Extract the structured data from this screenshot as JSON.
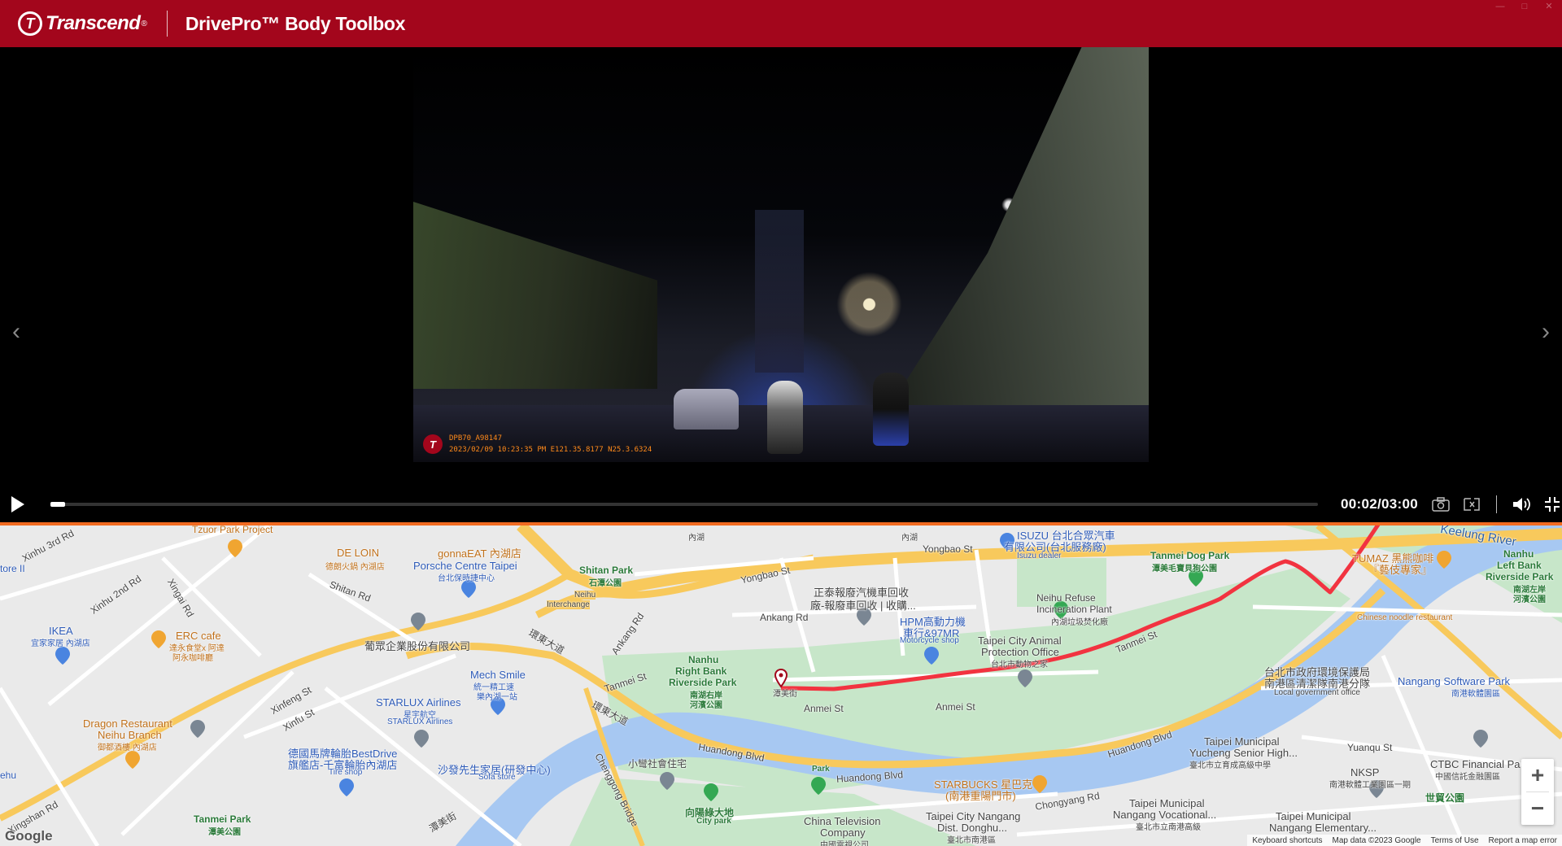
{
  "colors": {
    "brand": "#a3061c",
    "accent": "#f26b21",
    "route": "#f23340",
    "water": "#a7c8f2",
    "park": "#bfe2c2",
    "highway": "#f8c95c"
  },
  "header": {
    "brand_mark": "T",
    "brand_name": "Transcend",
    "brand_reg": "®",
    "app_title": "DrivePro™ Body Toolbox"
  },
  "window_controls": [
    "—",
    "□",
    "✕"
  ],
  "video": {
    "overlay_logo": "T",
    "overlay_line1": "DPB70_A98147",
    "overlay_line2": "2023/02/09 10:23:35 PM  E121.35.8177 N25.3.6324",
    "nav_prev": "‹",
    "nav_next": "›"
  },
  "player": {
    "time": "00:02/03:00",
    "progress_fraction": 0.011,
    "icons": [
      "play-icon",
      "camera-icon",
      "crop-icon",
      "volume-icon",
      "fullscreen-exit-icon"
    ]
  },
  "map": {
    "labels": [
      {
        "text": "Tzuor Park Project",
        "cls": "orange"
      },
      {
        "text": "Xinhu 3rd Rd",
        "cls": "road"
      },
      {
        "text": "tore II",
        "cls": "blue"
      },
      {
        "text": "DE LOIN",
        "cls": "orange"
      },
      {
        "text": "德朗火鍋 內湖店",
        "cls": "orange small"
      },
      {
        "text": "gonnaEAT 內湖店",
        "cls": "orange"
      },
      {
        "text": "Porsche Centre Taipei",
        "cls": "blue"
      },
      {
        "text": "台北保時捷中心",
        "cls": "blue small"
      },
      {
        "text": "Xinhu 2nd Rd",
        "cls": "road"
      },
      {
        "text": "Xingai Rd",
        "cls": "road"
      },
      {
        "text": "Shitan Rd",
        "cls": "road"
      },
      {
        "text": "Shitan Park",
        "cls": "green"
      },
      {
        "text": "石潭公園",
        "cls": "green small"
      },
      {
        "text": "Neihu",
        "cls": "road"
      },
      {
        "text": "Interchange",
        "cls": "road"
      },
      {
        "text": "內湖",
        "cls": "road small"
      },
      {
        "text": "內湖",
        "cls": "road small"
      },
      {
        "text": "Yongbao St",
        "cls": "road"
      },
      {
        "text": "Yongbao St",
        "cls": "road"
      },
      {
        "text": "ISUZU 台北合眾汽車",
        "cls": "blue"
      },
      {
        "text": "有限公司(台北服務廠)",
        "cls": "blue"
      },
      {
        "text": "Isuzu dealer",
        "cls": "blue small"
      },
      {
        "text": "Tanmei Dog Park",
        "cls": "green"
      },
      {
        "text": "潭美毛寶貝狗公園",
        "cls": "green small"
      },
      {
        "text": "Keelung River",
        "cls": "river"
      },
      {
        "text": "TUMAZ 黑熊咖啡",
        "cls": "orange"
      },
      {
        "text": "『藝伎專家』",
        "cls": "orange"
      },
      {
        "text": "Nanhu",
        "cls": "green"
      },
      {
        "text": "Left Bank",
        "cls": "green"
      },
      {
        "text": "Riverside Park",
        "cls": "green"
      },
      {
        "text": "南湖左岸",
        "cls": "green small"
      },
      {
        "text": "河濱公園",
        "cls": "green small"
      },
      {
        "text": "正泰報廢汽機車回收",
        "cls": "road"
      },
      {
        "text": "廠-報廢車回收 | 收購...",
        "cls": "road"
      },
      {
        "text": "Neihu Refuse",
        "cls": "road"
      },
      {
        "text": "Incineration Plant",
        "cls": "road"
      },
      {
        "text": "內湖垃圾焚化廠",
        "cls": "road small"
      },
      {
        "text": "IKEA",
        "cls": "blue"
      },
      {
        "text": "宜家家居 內湖店",
        "cls": "blue small"
      },
      {
        "text": "ERC cafe",
        "cls": "orange"
      },
      {
        "text": "達永食堂x 阿達",
        "cls": "orange small"
      },
      {
        "text": "阿永咖啡廳",
        "cls": "orange small"
      },
      {
        "text": "葡眾企業股份有限公司",
        "cls": "road"
      },
      {
        "text": "Ankang Rd",
        "cls": "road"
      },
      {
        "text": "Ankang Rd",
        "cls": "road"
      },
      {
        "text": "HPM高動力機",
        "cls": "blue"
      },
      {
        "text": "車行&97MR",
        "cls": "blue"
      },
      {
        "text": "Motorcycle shop",
        "cls": "blue small"
      },
      {
        "text": "Taipei City Animal",
        "cls": "road"
      },
      {
        "text": "Protection Office",
        "cls": "road"
      },
      {
        "text": "台北市動物之家",
        "cls": "road small"
      },
      {
        "text": "Tanmei St",
        "cls": "road"
      },
      {
        "text": "Chinese noodle restaurant",
        "cls": "orange small"
      },
      {
        "text": "台北市政府環境保護局",
        "cls": "road"
      },
      {
        "text": "南港區清潔隊南港分隊",
        "cls": "road"
      },
      {
        "text": "Local government office",
        "cls": "road small"
      },
      {
        "text": "Nangang Software Park",
        "cls": "blue"
      },
      {
        "text": "南港軟體園區",
        "cls": "blue small"
      },
      {
        "text": "Mech Smile",
        "cls": "blue"
      },
      {
        "text": "統一精工速",
        "cls": "blue small"
      },
      {
        "text": "樂內湖一站",
        "cls": "blue small"
      },
      {
        "text": "環東大道",
        "cls": "road"
      },
      {
        "text": "Tanmei St",
        "cls": "road"
      },
      {
        "text": "Nanhu",
        "cls": "green"
      },
      {
        "text": "Right Bank",
        "cls": "green"
      },
      {
        "text": "Riverside Park",
        "cls": "green"
      },
      {
        "text": "南湖右岸",
        "cls": "green small"
      },
      {
        "text": "河濱公園",
        "cls": "green small"
      },
      {
        "text": "潭美街",
        "cls": "road small"
      },
      {
        "text": "Anmei St",
        "cls": "road"
      },
      {
        "text": "Anmei St",
        "cls": "road"
      },
      {
        "text": "Xinfeng St",
        "cls": "road"
      },
      {
        "text": "Xinfu St",
        "cls": "road"
      },
      {
        "text": "STARLUX Airlines",
        "cls": "blue"
      },
      {
        "text": "星宇航空",
        "cls": "blue small"
      },
      {
        "text": "STARLUX Airlines",
        "cls": "blue small"
      },
      {
        "text": "環東大道",
        "cls": "road"
      },
      {
        "text": "Dragon Restaurant",
        "cls": "orange"
      },
      {
        "text": "Neihu Branch",
        "cls": "orange"
      },
      {
        "text": "御都酒樓 內湖店",
        "cls": "orange small"
      },
      {
        "text": "德國馬牌輪胎BestDrive",
        "cls": "blue"
      },
      {
        "text": "旗艦店-千富輪胎內湖店",
        "cls": "blue"
      },
      {
        "text": "Tire shop",
        "cls": "blue small"
      },
      {
        "text": "沙發先生家居(研發中心)",
        "cls": "blue"
      },
      {
        "text": "Sofa store",
        "cls": "blue small"
      },
      {
        "text": "Chenggong Bridge",
        "cls": "road"
      },
      {
        "text": "小彎社會住宅",
        "cls": "road"
      },
      {
        "text": "Huandong Blvd",
        "cls": "road"
      },
      {
        "text": "Park",
        "cls": "green small"
      },
      {
        "text": "Huandong Blvd",
        "cls": "road"
      },
      {
        "text": "Huandong Blvd",
        "cls": "road"
      },
      {
        "text": "STARBUCKS 星巴克",
        "cls": "orange"
      },
      {
        "text": "(南港重陽門市)",
        "cls": "orange"
      },
      {
        "text": "Taipei Municipal",
        "cls": "road"
      },
      {
        "text": "Yucheng Senior High...",
        "cls": "road"
      },
      {
        "text": "臺北市立育成高級中學",
        "cls": "road small"
      },
      {
        "text": "Yuanqu St",
        "cls": "road"
      },
      {
        "text": "NKSP",
        "cls": "road"
      },
      {
        "text": "南港軟體工業園區一期",
        "cls": "road small"
      },
      {
        "text": "CTBC Financial Pa",
        "cls": "road"
      },
      {
        "text": "中國信託金融園區",
        "cls": "road small"
      },
      {
        "text": "世貿公園",
        "cls": "green"
      },
      {
        "text": "ehu",
        "cls": "blue"
      },
      {
        "text": "Xingshan Rd",
        "cls": "road"
      },
      {
        "text": "Tanmei Park",
        "cls": "green"
      },
      {
        "text": "潭美公園",
        "cls": "green small"
      },
      {
        "text": "潭美街",
        "cls": "road"
      },
      {
        "text": "向陽綠大地",
        "cls": "green"
      },
      {
        "text": "City park",
        "cls": "green small"
      },
      {
        "text": "China Television",
        "cls": "road"
      },
      {
        "text": "Company",
        "cls": "road"
      },
      {
        "text": "中國電視公司",
        "cls": "road small"
      },
      {
        "text": "Chongyang Rd",
        "cls": "road"
      },
      {
        "text": "Taipei City Nangang",
        "cls": "road"
      },
      {
        "text": "Dist. Donghu...",
        "cls": "road"
      },
      {
        "text": "臺北市南港區",
        "cls": "road small"
      },
      {
        "text": "Taipei Municipal",
        "cls": "road"
      },
      {
        "text": "Nangang Vocational...",
        "cls": "road"
      },
      {
        "text": "臺北市立南港高級",
        "cls": "road small"
      },
      {
        "text": "Taipei Municipal",
        "cls": "road"
      },
      {
        "text": "Nangang Elementary...",
        "cls": "road"
      }
    ],
    "google_logo": "Google",
    "footer": [
      "Keyboard shortcuts",
      "Map data ©2023 Google",
      "Terms of Use",
      "Report a map error"
    ],
    "zoom_in": "+",
    "zoom_out": "−"
  }
}
